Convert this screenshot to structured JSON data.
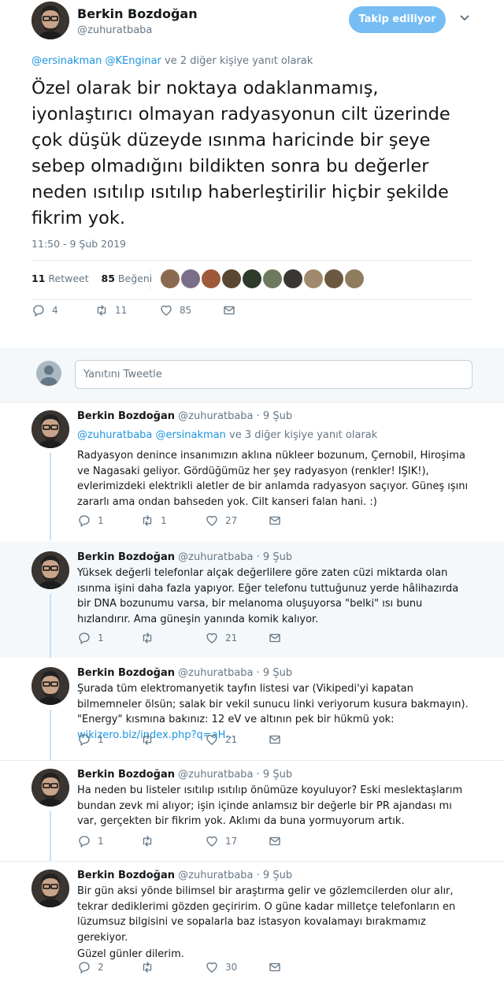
{
  "main": {
    "author_name": "Berkin Bozdoğan",
    "author_handle": "@zuhuratbaba",
    "follow_label": "Takip ediliyor",
    "reply_to_user1": "@ersinakman",
    "reply_to_user2": "@KEnginar",
    "reply_to_suffix": " ve 2 diğer kişiye yanıt olarak",
    "text": "Özel olarak bir noktaya odaklanmamış, iyonlaştırıcı olmayan radyasyonun cilt üzerinde çok düşük düzeyde ısınma haricinde bir şeye sebep olmadığını bildikten sonra bu değerler neden ısıtılıp ısıtılıp haberleştirilir hiçbir şekilde fikrim yok.",
    "timestamp": "11:50 - 9 Şub 2019",
    "retweet_count": "11",
    "retweet_label": "Retweet",
    "like_count": "85",
    "like_label": "Beğeni",
    "replies": "4",
    "retweets": "11",
    "likes": "85"
  },
  "reply_box": {
    "placeholder": "Yanıtını Tweetle"
  },
  "replies": [
    {
      "name": "Berkin Bozdoğan",
      "handle": "@zuhuratbaba",
      "date": "· 9 Şub",
      "reply_to_user1": "@zuhuratbaba",
      "reply_to_user2": "@ersinakman",
      "reply_to_suffix": " ve 3 diğer kişiye yanıt olarak",
      "text": "Radyasyon denince insanımızın aklına nükleer bozunum, Çernobil, Hiroşima ve Nagasaki geliyor. Gördüğümüz her şey radyasyon (renkler! IŞIK!), evlerimizdeki elektrikli aletler de bir anlamda radyasyon saçıyor. Güneş ışını zararlı ama ondan bahseden yok. Cilt kanseri falan hani. :)",
      "replies": "1",
      "retweets": "1",
      "likes": "27"
    },
    {
      "name": "Berkin Bozdoğan",
      "handle": "@zuhuratbaba",
      "date": "· 9 Şub",
      "text": "Yüksek değerli telefonlar alçak değerlilere göre zaten cüzi miktarda olan ısınma işini daha fazla yapıyor. Eğer telefonu tuttuğunuz yerde hâlihazırda bir DNA bozunumu varsa, bir melanoma oluşuyorsa \"belki\" ısı bunu hızlandırır. Ama güneşin yanında komik kalıyor.",
      "replies": "1",
      "retweets": "",
      "likes": "21"
    },
    {
      "name": "Berkin Bozdoğan",
      "handle": "@zuhuratbaba",
      "date": "· 9 Şub",
      "text": "Şurada tüm elektromanyetik tayfın listesi var (Vikipedi'yi kapatan bilmemneler ölsün; salak bir vekil sunucu linki veriyorum kusura bakmayın). \"Energy\" kısmına bakınız: 12 eV ve altının pek bir hükmü yok: ",
      "link": "wikizero.biz/index.php?q=aH…",
      "replies": "1",
      "retweets": "",
      "likes": "21"
    },
    {
      "name": "Berkin Bozdoğan",
      "handle": "@zuhuratbaba",
      "date": "· 9 Şub",
      "text": "Ha neden bu listeler ısıtılıp ısıtılıp önümüze koyuluyor? Eski meslektaşlarım bundan zevk mi alıyor; işin içinde anlamsız bir değerle bir PR ajandası mı var, gerçekten bir fikrim yok. Aklımı da buna yormuyorum artık.",
      "replies": "1",
      "retweets": "",
      "likes": "17"
    },
    {
      "name": "Berkin Bozdoğan",
      "handle": "@zuhuratbaba",
      "date": "· 9 Şub",
      "text": "Bir gün aksi yönde bilimsel bir araştırma gelir ve gözlemcilerden olur alır, tekrar dediklerimi gözden geçiririm. O güne kadar milletçe telefonların en lüzumsuz bilgisini ve sopalarla baz istasyon kovalamayı bırakmamız gerekiyor.",
      "text2": "Güzel günler dilerim.",
      "replies": "2",
      "retweets": "",
      "likes": "30"
    }
  ],
  "colors": {
    "accent": "#1b95e0",
    "follow_bg": "#75bdf3",
    "muted": "#657786",
    "thread": "#c4e3f7"
  },
  "icons": [
    "reply-icon",
    "retweet-icon",
    "like-icon",
    "message-icon",
    "chevron-down-icon"
  ]
}
